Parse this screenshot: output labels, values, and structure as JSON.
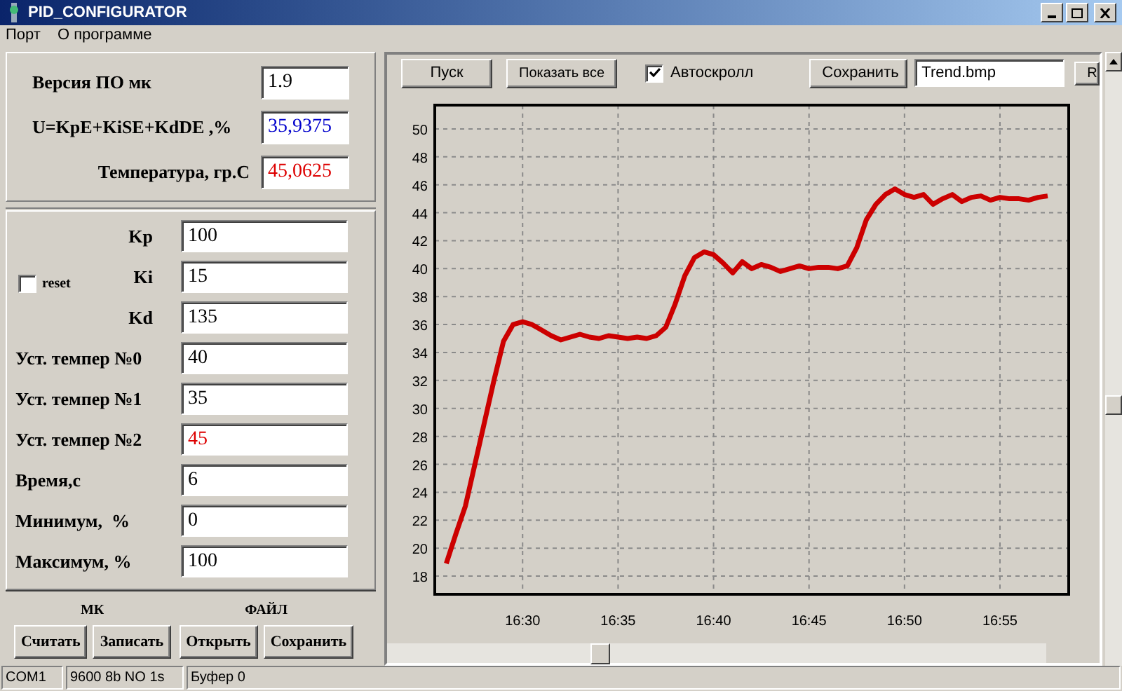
{
  "window": {
    "title": "PID_CONFIGURATOR"
  },
  "menu": [
    "Порт",
    "О программе"
  ],
  "info_fields": [
    {
      "label": "Версия ПО мк",
      "value": "1.9",
      "color": "#000000"
    },
    {
      "label": "U=KpE+KiSE+KdDE ,%",
      "value": "35,9375",
      "color": "#0000cc"
    },
    {
      "label": "Температура, гр.С",
      "value": "45,0625",
      "color": "#dd0000"
    }
  ],
  "reset": {
    "label": "reset",
    "checked": false
  },
  "params": [
    {
      "label": "Kp",
      "value": "100",
      "color": "#000000"
    },
    {
      "label": "Ki",
      "value": "15",
      "color": "#000000"
    },
    {
      "label": "Kd",
      "value": "135",
      "color": "#000000"
    },
    {
      "label": "Уст. темпер №0",
      "value": "40",
      "color": "#000000"
    },
    {
      "label": "Уст. темпер №1",
      "value": "35",
      "color": "#000000"
    },
    {
      "label": "Уст. темпер №2",
      "value": "45",
      "color": "#dd0000"
    },
    {
      "label": "Время,с",
      "value": "6",
      "color": "#000000"
    },
    {
      "label": "Минимум,  %",
      "value": "0",
      "color": "#000000"
    },
    {
      "label": "Максимум, %",
      "value": "100",
      "color": "#000000"
    }
  ],
  "button_groups": [
    {
      "title": "МК",
      "buttons": [
        "Считать",
        "Записать"
      ]
    },
    {
      "title": "ФАЙЛ",
      "buttons": [
        "Открыть",
        "Сохранить"
      ]
    }
  ],
  "toolbar": {
    "start": "Пуск",
    "show_all": "Показать все",
    "autoscroll": {
      "label": "Автоскролл",
      "checked": true
    },
    "save": "Сохранить",
    "file": "Trend.bmp",
    "r": "R"
  },
  "chart_data": {
    "type": "line",
    "grid": true,
    "ylim": [
      16.7,
      51.7
    ],
    "categories": [
      null,
      null,
      null,
      null,
      null,
      null,
      null,
      null,
      "16:30",
      null,
      null,
      null,
      null,
      null,
      null,
      null,
      null,
      null,
      "16:35",
      null,
      null,
      null,
      null,
      null,
      null,
      null,
      null,
      null,
      "16:40",
      null,
      null,
      null,
      null,
      null,
      null,
      null,
      null,
      null,
      "16:45",
      null,
      null,
      null,
      null,
      null,
      null,
      null,
      null,
      null,
      "16:50",
      null,
      null,
      null,
      null,
      null,
      null,
      null,
      null,
      null,
      "16:55",
      null,
      null,
      null,
      null,
      null
    ],
    "yticks": [
      18,
      20,
      22,
      24,
      26,
      28,
      30,
      32,
      34,
      36,
      38,
      40,
      42,
      44,
      46,
      48,
      50
    ],
    "series": [
      {
        "color": "#cc0000",
        "values": [
          18.9,
          21,
          23,
          26,
          29,
          32,
          34.8,
          36,
          36.2,
          36,
          35.6,
          35.2,
          34.9,
          35.1,
          35.3,
          35.1,
          35,
          35.2,
          35.1,
          35,
          35.1,
          35,
          35.2,
          35.8,
          37.5,
          39.5,
          40.8,
          41.2,
          41,
          40.4,
          39.7,
          40.5,
          40,
          40.3,
          40.1,
          39.8,
          40,
          40.2,
          40,
          40.1,
          40.1,
          40,
          40.2,
          41.5,
          43.5,
          44.6,
          45.3,
          45.7,
          45.3,
          45.1,
          45.3,
          44.6,
          45,
          45.3,
          44.8,
          45.1,
          45.2,
          44.9,
          45.1,
          45,
          45,
          44.9,
          45.1,
          45.2
        ]
      }
    ]
  },
  "status_bar": [
    "COM1",
    "9600 8b NO 1s",
    "Буфер 0"
  ]
}
